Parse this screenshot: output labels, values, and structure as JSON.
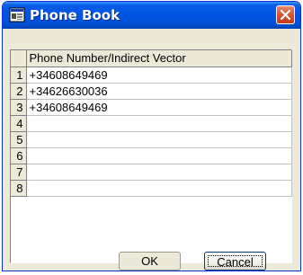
{
  "window": {
    "title": "Phone Book",
    "icon": "phone-book-icon",
    "accent": "#0054e3",
    "close_color": "#d8532f"
  },
  "grid": {
    "column_header": "Phone Number/Indirect Vector",
    "rows": [
      {
        "num": "1",
        "value": "+34608649469"
      },
      {
        "num": "2",
        "value": "+34626630036"
      },
      {
        "num": "3",
        "value": "+34608649469"
      },
      {
        "num": "4",
        "value": ""
      },
      {
        "num": "5",
        "value": ""
      },
      {
        "num": "6",
        "value": ""
      },
      {
        "num": "7",
        "value": ""
      },
      {
        "num": "8",
        "value": ""
      }
    ]
  },
  "buttons": {
    "ok_label": "OK",
    "cancel_label": "Cancel"
  }
}
